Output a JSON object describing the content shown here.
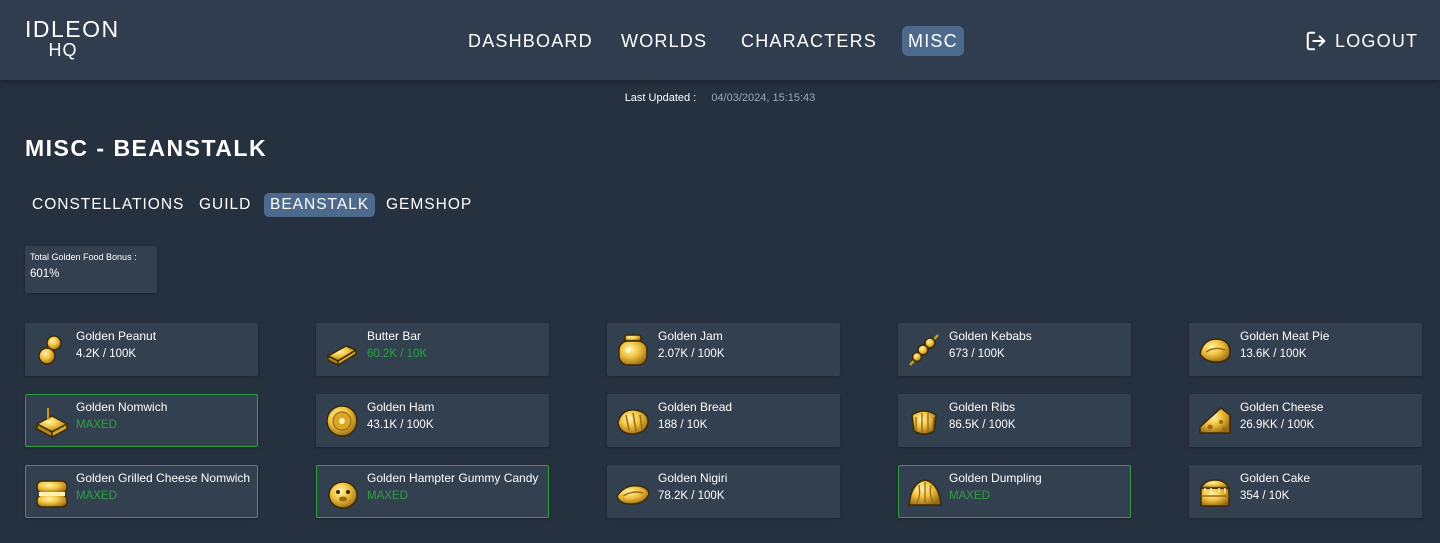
{
  "header": {
    "logo_line1": "IDLEON",
    "logo_line2": "HQ",
    "nav": [
      "DASHBOARD",
      "WORLDS",
      "CHARACTERS",
      "MISC"
    ],
    "active_nav": "MISC",
    "logout_label": "LOGOUT"
  },
  "updated": {
    "label": "Last Updated :",
    "value": "04/03/2024, 15:15:43"
  },
  "page_title": "MISC - BEANSTALK",
  "subtabs": [
    "CONSTELLATIONS",
    "GUILD",
    "BEANSTALK",
    "GEMSHOP"
  ],
  "active_subtab": "BEANSTALK",
  "bonus": {
    "label": "Total Golden Food Bonus :",
    "value": "601%"
  },
  "foods": [
    {
      "name": "Golden Peanut",
      "amount": "4.2K / 100K",
      "state": "normal",
      "icon": "peanut-icon"
    },
    {
      "name": "Butter Bar",
      "amount": "60.2K / 10K",
      "state": "complete",
      "icon": "butter-bar-icon"
    },
    {
      "name": "Golden Jam",
      "amount": "2.07K / 100K",
      "state": "normal",
      "icon": "jam-jar-icon"
    },
    {
      "name": "Golden Kebabs",
      "amount": "673 / 100K",
      "state": "normal",
      "icon": "kebab-icon"
    },
    {
      "name": "Golden Meat Pie",
      "amount": "13.6K / 100K",
      "state": "normal",
      "icon": "meat-pie-icon"
    },
    {
      "name": "Golden Nomwich",
      "amount": "MAXED",
      "state": "maxed",
      "icon": "nomwich-icon"
    },
    {
      "name": "Golden Ham",
      "amount": "43.1K / 100K",
      "state": "normal",
      "icon": "ham-icon"
    },
    {
      "name": "Golden Bread",
      "amount": "188 / 10K",
      "state": "normal",
      "icon": "bread-icon"
    },
    {
      "name": "Golden Ribs",
      "amount": "86.5K / 100K",
      "state": "normal",
      "icon": "ribs-icon"
    },
    {
      "name": "Golden Cheese",
      "amount": "26.9KK / 100K",
      "state": "normal",
      "icon": "cheese-icon"
    },
    {
      "name": "Golden Grilled Cheese Nomwich",
      "amount": "MAXED",
      "state": "maxed",
      "icon": "grilled-cheese-icon"
    },
    {
      "name": "Golden Hampter Gummy Candy",
      "amount": "MAXED",
      "state": "maxed",
      "icon": "gummy-candy-icon"
    },
    {
      "name": "Golden Nigiri",
      "amount": "78.2K / 100K",
      "state": "normal",
      "icon": "nigiri-icon"
    },
    {
      "name": "Golden Dumpling",
      "amount": "MAXED",
      "state": "maxed",
      "icon": "dumpling-icon"
    },
    {
      "name": "Golden Cake",
      "amount": "354 / 10K",
      "state": "normal",
      "icon": "cake-icon"
    }
  ],
  "colors": {
    "background": "#26313f",
    "topbar": "#2f3d4f",
    "card": "#33404f",
    "active_tab": "#4d6a8c",
    "maxed_green": "#2ea043",
    "gold": "#e8b830"
  }
}
